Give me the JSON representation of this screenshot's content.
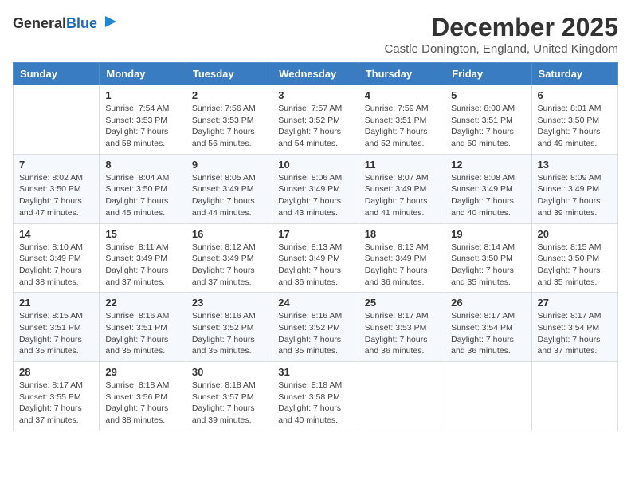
{
  "header": {
    "logo_general": "General",
    "logo_blue": "Blue",
    "month_title": "December 2025",
    "location": "Castle Donington, England, United Kingdom"
  },
  "weekdays": [
    "Sunday",
    "Monday",
    "Tuesday",
    "Wednesday",
    "Thursday",
    "Friday",
    "Saturday"
  ],
  "weeks": [
    [
      {
        "day": "",
        "sunrise": "",
        "sunset": "",
        "daylight": ""
      },
      {
        "day": "1",
        "sunrise": "Sunrise: 7:54 AM",
        "sunset": "Sunset: 3:53 PM",
        "daylight": "Daylight: 7 hours and 58 minutes."
      },
      {
        "day": "2",
        "sunrise": "Sunrise: 7:56 AM",
        "sunset": "Sunset: 3:53 PM",
        "daylight": "Daylight: 7 hours and 56 minutes."
      },
      {
        "day": "3",
        "sunrise": "Sunrise: 7:57 AM",
        "sunset": "Sunset: 3:52 PM",
        "daylight": "Daylight: 7 hours and 54 minutes."
      },
      {
        "day": "4",
        "sunrise": "Sunrise: 7:59 AM",
        "sunset": "Sunset: 3:51 PM",
        "daylight": "Daylight: 7 hours and 52 minutes."
      },
      {
        "day": "5",
        "sunrise": "Sunrise: 8:00 AM",
        "sunset": "Sunset: 3:51 PM",
        "daylight": "Daylight: 7 hours and 50 minutes."
      },
      {
        "day": "6",
        "sunrise": "Sunrise: 8:01 AM",
        "sunset": "Sunset: 3:50 PM",
        "daylight": "Daylight: 7 hours and 49 minutes."
      }
    ],
    [
      {
        "day": "7",
        "sunrise": "Sunrise: 8:02 AM",
        "sunset": "Sunset: 3:50 PM",
        "daylight": "Daylight: 7 hours and 47 minutes."
      },
      {
        "day": "8",
        "sunrise": "Sunrise: 8:04 AM",
        "sunset": "Sunset: 3:50 PM",
        "daylight": "Daylight: 7 hours and 45 minutes."
      },
      {
        "day": "9",
        "sunrise": "Sunrise: 8:05 AM",
        "sunset": "Sunset: 3:49 PM",
        "daylight": "Daylight: 7 hours and 44 minutes."
      },
      {
        "day": "10",
        "sunrise": "Sunrise: 8:06 AM",
        "sunset": "Sunset: 3:49 PM",
        "daylight": "Daylight: 7 hours and 43 minutes."
      },
      {
        "day": "11",
        "sunrise": "Sunrise: 8:07 AM",
        "sunset": "Sunset: 3:49 PM",
        "daylight": "Daylight: 7 hours and 41 minutes."
      },
      {
        "day": "12",
        "sunrise": "Sunrise: 8:08 AM",
        "sunset": "Sunset: 3:49 PM",
        "daylight": "Daylight: 7 hours and 40 minutes."
      },
      {
        "day": "13",
        "sunrise": "Sunrise: 8:09 AM",
        "sunset": "Sunset: 3:49 PM",
        "daylight": "Daylight: 7 hours and 39 minutes."
      }
    ],
    [
      {
        "day": "14",
        "sunrise": "Sunrise: 8:10 AM",
        "sunset": "Sunset: 3:49 PM",
        "daylight": "Daylight: 7 hours and 38 minutes."
      },
      {
        "day": "15",
        "sunrise": "Sunrise: 8:11 AM",
        "sunset": "Sunset: 3:49 PM",
        "daylight": "Daylight: 7 hours and 37 minutes."
      },
      {
        "day": "16",
        "sunrise": "Sunrise: 8:12 AM",
        "sunset": "Sunset: 3:49 PM",
        "daylight": "Daylight: 7 hours and 37 minutes."
      },
      {
        "day": "17",
        "sunrise": "Sunrise: 8:13 AM",
        "sunset": "Sunset: 3:49 PM",
        "daylight": "Daylight: 7 hours and 36 minutes."
      },
      {
        "day": "18",
        "sunrise": "Sunrise: 8:13 AM",
        "sunset": "Sunset: 3:49 PM",
        "daylight": "Daylight: 7 hours and 36 minutes."
      },
      {
        "day": "19",
        "sunrise": "Sunrise: 8:14 AM",
        "sunset": "Sunset: 3:50 PM",
        "daylight": "Daylight: 7 hours and 35 minutes."
      },
      {
        "day": "20",
        "sunrise": "Sunrise: 8:15 AM",
        "sunset": "Sunset: 3:50 PM",
        "daylight": "Daylight: 7 hours and 35 minutes."
      }
    ],
    [
      {
        "day": "21",
        "sunrise": "Sunrise: 8:15 AM",
        "sunset": "Sunset: 3:51 PM",
        "daylight": "Daylight: 7 hours and 35 minutes."
      },
      {
        "day": "22",
        "sunrise": "Sunrise: 8:16 AM",
        "sunset": "Sunset: 3:51 PM",
        "daylight": "Daylight: 7 hours and 35 minutes."
      },
      {
        "day": "23",
        "sunrise": "Sunrise: 8:16 AM",
        "sunset": "Sunset: 3:52 PM",
        "daylight": "Daylight: 7 hours and 35 minutes."
      },
      {
        "day": "24",
        "sunrise": "Sunrise: 8:16 AM",
        "sunset": "Sunset: 3:52 PM",
        "daylight": "Daylight: 7 hours and 35 minutes."
      },
      {
        "day": "25",
        "sunrise": "Sunrise: 8:17 AM",
        "sunset": "Sunset: 3:53 PM",
        "daylight": "Daylight: 7 hours and 36 minutes."
      },
      {
        "day": "26",
        "sunrise": "Sunrise: 8:17 AM",
        "sunset": "Sunset: 3:54 PM",
        "daylight": "Daylight: 7 hours and 36 minutes."
      },
      {
        "day": "27",
        "sunrise": "Sunrise: 8:17 AM",
        "sunset": "Sunset: 3:54 PM",
        "daylight": "Daylight: 7 hours and 37 minutes."
      }
    ],
    [
      {
        "day": "28",
        "sunrise": "Sunrise: 8:17 AM",
        "sunset": "Sunset: 3:55 PM",
        "daylight": "Daylight: 7 hours and 37 minutes."
      },
      {
        "day": "29",
        "sunrise": "Sunrise: 8:18 AM",
        "sunset": "Sunset: 3:56 PM",
        "daylight": "Daylight: 7 hours and 38 minutes."
      },
      {
        "day": "30",
        "sunrise": "Sunrise: 8:18 AM",
        "sunset": "Sunset: 3:57 PM",
        "daylight": "Daylight: 7 hours and 39 minutes."
      },
      {
        "day": "31",
        "sunrise": "Sunrise: 8:18 AM",
        "sunset": "Sunset: 3:58 PM",
        "daylight": "Daylight: 7 hours and 40 minutes."
      },
      {
        "day": "",
        "sunrise": "",
        "sunset": "",
        "daylight": ""
      },
      {
        "day": "",
        "sunrise": "",
        "sunset": "",
        "daylight": ""
      },
      {
        "day": "",
        "sunrise": "",
        "sunset": "",
        "daylight": ""
      }
    ]
  ]
}
